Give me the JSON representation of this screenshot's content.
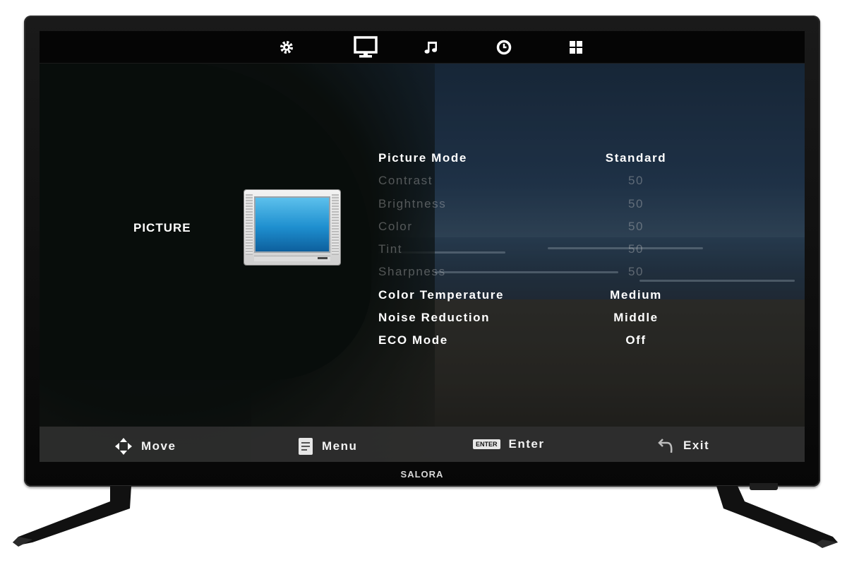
{
  "device": {
    "brand": "SALORA"
  },
  "top_bar": {
    "tabs": [
      {
        "icon": "gear-icon",
        "active": false
      },
      {
        "icon": "monitor-icon",
        "active": true
      },
      {
        "icon": "music-note-icon",
        "active": false
      },
      {
        "icon": "clock-icon",
        "active": false
      },
      {
        "icon": "grid-icon",
        "active": false
      }
    ]
  },
  "panel": {
    "title": "PICTURE",
    "thumbnail_icon": "tv-picture-icon"
  },
  "settings": [
    {
      "label": "Picture Mode",
      "value": "Standard",
      "enabled": true
    },
    {
      "label": "Contrast",
      "value": "50",
      "enabled": false
    },
    {
      "label": "Brightness",
      "value": "50",
      "enabled": false
    },
    {
      "label": "Color",
      "value": "50",
      "enabled": false
    },
    {
      "label": "Tint",
      "value": "50",
      "enabled": false
    },
    {
      "label": "Sharpness",
      "value": "50",
      "enabled": false
    },
    {
      "label": "Color Temperature",
      "value": "Medium",
      "enabled": true
    },
    {
      "label": "Noise Reduction",
      "value": "Middle",
      "enabled": true
    },
    {
      "label": "ECO Mode",
      "value": "Off",
      "enabled": true
    }
  ],
  "help_bar": {
    "move": {
      "icon": "dpad-arrows-icon",
      "label": "Move"
    },
    "menu": {
      "icon": "menu-icon",
      "label": "Menu"
    },
    "enter": {
      "key": "ENTER",
      "label": "Enter"
    },
    "exit": {
      "icon": "return-arrow-icon",
      "label": "Exit"
    }
  },
  "colors": {
    "text": "#ffffff",
    "disabled_text": "#8c8c8c",
    "bezel": "#0a0a0a",
    "help_bar": "#303030"
  }
}
